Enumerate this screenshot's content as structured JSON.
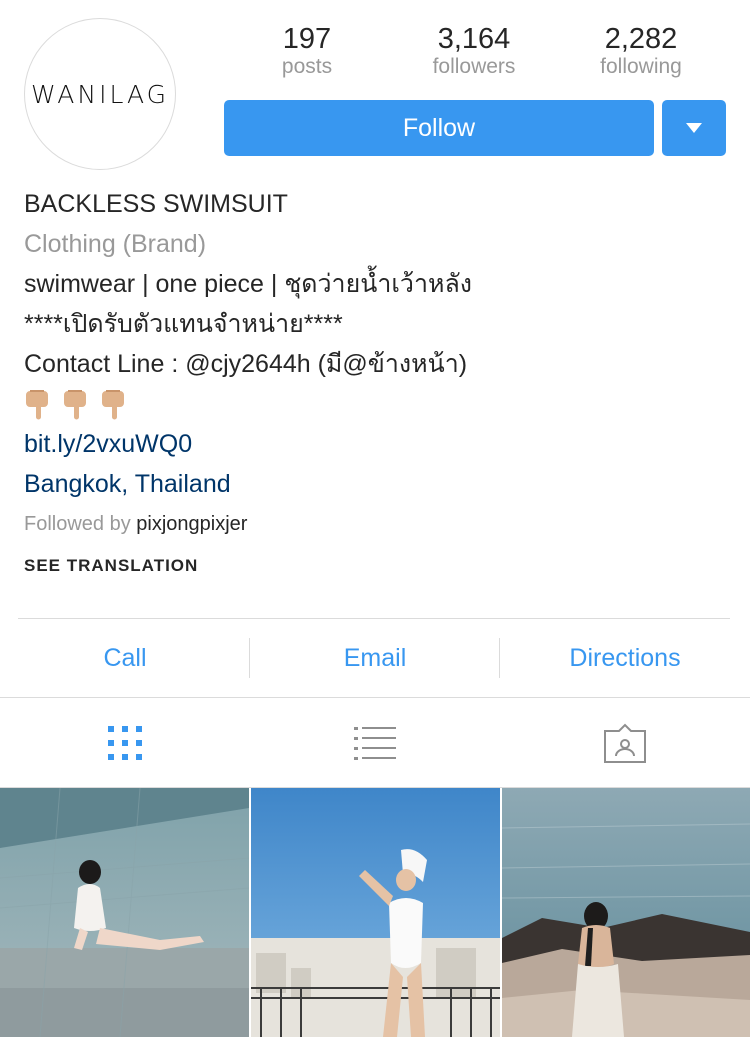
{
  "profile": {
    "avatar_text": "WANILAG",
    "stats": [
      {
        "value": "197",
        "label": "posts"
      },
      {
        "value": "3,164",
        "label": "followers"
      },
      {
        "value": "2,282",
        "label": "following"
      }
    ],
    "follow_label": "Follow",
    "name": "BACKLESS SWIMSUIT",
    "category": "Clothing (Brand)",
    "bio_lines": [
      "swimwear | one piece | ชุดว่ายน้ำเว้าหลัง",
      "****เปิดรับตัวแทนจำหน่าย****",
      "Contact Line : @cjy2644h (มี@ข้างหน้า)"
    ],
    "link": "bit.ly/2vxuWQ0",
    "location": "Bangkok, Thailand",
    "followed_by_prefix": "Followed by",
    "followed_by_user": "pixjongpixjer",
    "see_translation": "SEE TRANSLATION"
  },
  "actions": [
    "Call",
    "Email",
    "Directions"
  ],
  "tabs": [
    "grid-icon",
    "list-icon",
    "tagged-icon"
  ],
  "colors": {
    "accent": "#3897f0",
    "link": "#003569",
    "muted": "#999999"
  }
}
